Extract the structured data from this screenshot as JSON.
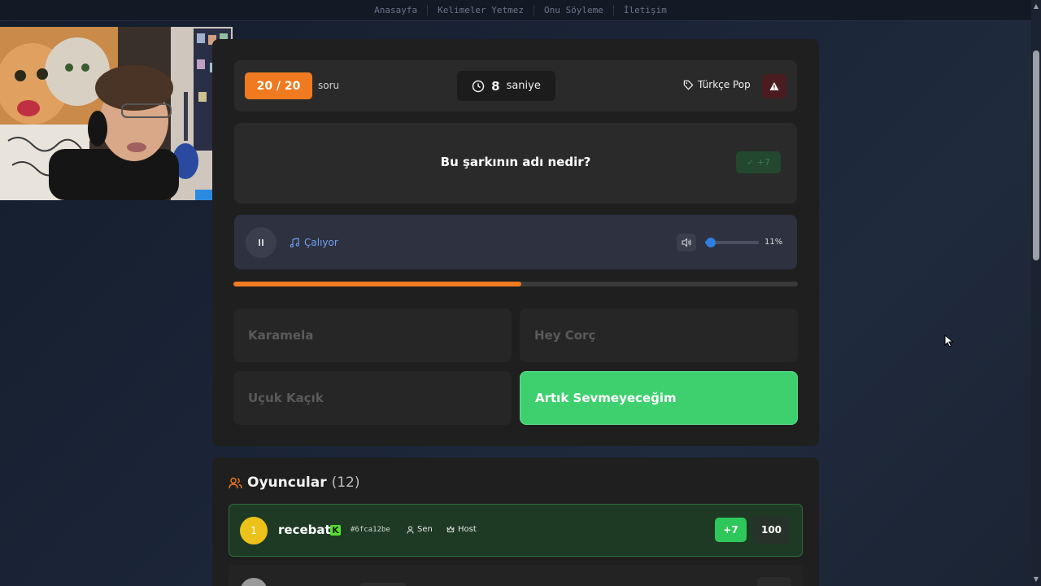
{
  "nav": {
    "items": [
      "Anasayfa",
      "Kelimeler Yetmez",
      "Onu Söyleme",
      "İletişim"
    ]
  },
  "game": {
    "counter": "20 / 20",
    "counter_suffix": "soru",
    "timer_value": "8",
    "timer_unit": "saniye",
    "category": "Türkçe Pop",
    "question": "Bu şarkının adı nedir?",
    "points_badge": "✓ +7",
    "player_status": "Çalıyor",
    "volume_percent": "11%",
    "volume_level": 0.11,
    "progress": 0.51,
    "answers": [
      {
        "label": "Karamela",
        "state": "dim"
      },
      {
        "label": "Hey Corç",
        "state": "dim"
      },
      {
        "label": "Uçuk Kaçık",
        "state": "dim"
      },
      {
        "label": "Artık Sevmeyeceğim",
        "state": "correct"
      }
    ]
  },
  "players": {
    "title": "Oyuncular",
    "count": "(12)",
    "list": [
      {
        "rank": "1",
        "name": "recebat",
        "platform_logo": "K",
        "id": "#6fca12be",
        "you_label": "Sen",
        "host_label": "Host",
        "delta": "+7",
        "score": "100"
      }
    ]
  },
  "colors": {
    "accent_orange": "#f07a20",
    "correct_green": "#3ed06f",
    "gold": "#ecc21a",
    "blue": "#2d7fe0"
  }
}
